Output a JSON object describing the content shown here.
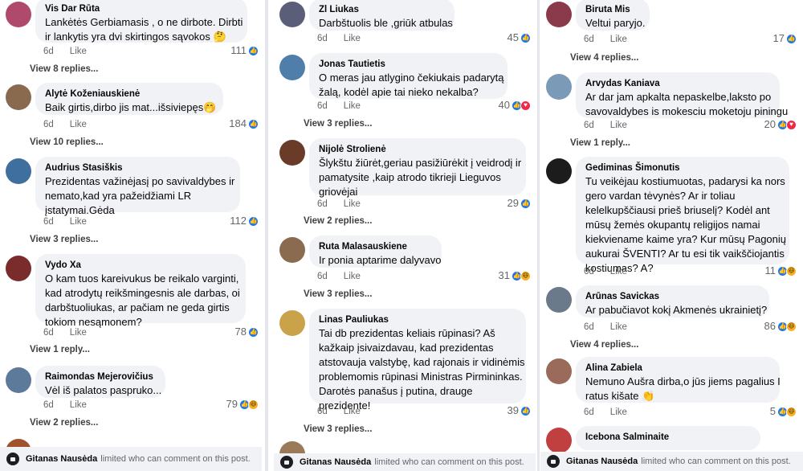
{
  "footer": {
    "name": "Gitanas Nausėda",
    "notice": "limited who can comment on this post."
  },
  "columns": [
    {
      "comments": [
        {
          "author": "Vis Dar Rūta",
          "lines": [
            "Lankėtės Gerbiamasis , o ne dirbote. Dirbti",
            "ir lankytis yra dvi skirtingos sąvokos 🤔"
          ],
          "time": "6d",
          "like": "Like",
          "count": "111",
          "reactions": [
            "like"
          ],
          "replies": "View 8 replies...",
          "avatar": "#b04a6c"
        },
        {
          "author": "Alytė Koženiauskienė",
          "lines": [
            "Baik girtis,dirbo jis mat...išsiviepęs🤭"
          ],
          "time": "6d",
          "like": "Like",
          "count": "184",
          "reactions": [
            "like"
          ],
          "replies": "View 10 replies...",
          "avatar": "#8a6a4e"
        },
        {
          "author": "Audrius Stasiškis",
          "lines": [
            "Prezidentas važinėjasį po savivaldybes ir",
            "nemato,kad yra pažeidžiami LR",
            "įstatymai.Gėda"
          ],
          "time": "6d",
          "like": "Like",
          "count": "112",
          "reactions": [
            "like"
          ],
          "replies": "View 3 replies...",
          "avatar": "#3f6f9e"
        },
        {
          "author": "Vydo Xa",
          "lines": [
            "O kam tuos kareivukus be reikalo varginti,",
            "kad atrodytų reikšmingesnis ale darbas, oi",
            "darbštuoliukas, ar pačiam ne geda girtis",
            "tokiom nesąmonem?"
          ],
          "time": "6d",
          "like": "Like",
          "count": "78",
          "reactions": [
            "like"
          ],
          "replies": "View 1 reply...",
          "avatar": "#7a2c2c"
        },
        {
          "author": "Raimondas Mejerovičius",
          "lines": [
            "Vėl iš palatos paspruko..."
          ],
          "time": "6d",
          "like": "Like",
          "count": "79",
          "reactions": [
            "like",
            "haha"
          ],
          "replies": "View 2 replies...",
          "avatar": "#5d7a9a"
        }
      ]
    },
    {
      "comments": [
        {
          "author": "Zl Liukas",
          "lines": [
            "Darbštuolis ble ,griūk atbulas"
          ],
          "time": "6d",
          "like": "Like",
          "count": "45",
          "reactions": [
            "like"
          ],
          "replies": "",
          "avatar": "#5a5e78"
        },
        {
          "author": "Jonas Tautietis",
          "lines": [
            "O meras jau atlygino čekiukais padarytą",
            "žalą, kodėl apie tai nieko nekalba?"
          ],
          "time": "6d",
          "like": "Like",
          "count": "40",
          "reactions": [
            "like",
            "love"
          ],
          "replies": "View 3 replies...",
          "avatar": "#4f7eaa"
        },
        {
          "author": "Nijolė Strolienė",
          "lines": [
            "Šlykštu žiūrėt,geriau pasižiūrėkit į veidrodį ir",
            "pamatysite ,kaip atrodo tikrieji Lieguvos",
            "griovėjai"
          ],
          "time": "6d",
          "like": "Like",
          "count": "29",
          "reactions": [
            "like"
          ],
          "replies": "View 2 replies...",
          "avatar": "#6b3b2a"
        },
        {
          "author": "Ruta Malasauskiene",
          "lines": [
            "Ir ponia aptarime dalyvavo"
          ],
          "time": "6d",
          "like": "Like",
          "count": "31",
          "reactions": [
            "like",
            "haha"
          ],
          "replies": "View 3 replies...",
          "avatar": "#8b6b50"
        },
        {
          "author": "Linas Pauliukas",
          "lines": [
            "Tai db prezidentas keliais rūpinasi? Aš",
            "kažkaip įsivaizdavau, kad prezidentas",
            "atstovauja valstybę, kad rajonais ir vidinėmis",
            "problemomis rūpinasi Ministras Pirmininkas.",
            "Darotės panašus į putina, drauge",
            "prezidente!"
          ],
          "time": "6d",
          "like": "Like",
          "count": "39",
          "reactions": [
            "like"
          ],
          "replies": "View 3 replies...",
          "avatar": "#c9a24a"
        }
      ]
    },
    {
      "comments": [
        {
          "author": "Biruta Mis",
          "lines": [
            "Veltui paryjo."
          ],
          "time": "6d",
          "like": "Like",
          "count": "17",
          "reactions": [
            "like"
          ],
          "replies": "View 4 replies...",
          "avatar": "#8a3a4a"
        },
        {
          "author": "Arvydas Kaniava",
          "lines": [
            "Ar dar jam apkalta nepaskelbe,laksto po",
            "savovaldybes is mokesciu moketoju piningu"
          ],
          "time": "6d",
          "like": "Like",
          "count": "20",
          "reactions": [
            "like",
            "love"
          ],
          "replies": "View 1 reply...",
          "avatar": "#7a9ab8"
        },
        {
          "author": "Gediminas Šimonutis",
          "lines": [
            "Tu veikėjau kostiumuotas, padarysi ka nors",
            "gero vardan tėvynės? Ar ir toliau",
            "kelelkupščiausi prieš briuselį? Kodėl ant",
            "mūsų žemės okupantų religijos namai",
            "kiekviename kaime yra? Kur mūsų Pagonių",
            "aukurai ŠVENTI? Ar tu esi tik vaikščiojantis",
            "kostiumas? A?"
          ],
          "time": "6d",
          "like": "Like",
          "count": "11",
          "reactions": [
            "like",
            "haha"
          ],
          "replies": "",
          "avatar": "#1c1c1c"
        },
        {
          "author": "Arūnas Savickas",
          "lines": [
            "Ar pabučiavot kokį Akmenės ukrainietį?"
          ],
          "time": "6d",
          "like": "Like",
          "count": "86",
          "reactions": [
            "like",
            "haha"
          ],
          "replies": "View 4 replies...",
          "avatar": "#6a7a8a"
        },
        {
          "author": "Alina Zabiela",
          "lines": [
            "Nemuno Aušra dirba,o jūs jiems pagalius I",
            "ratus kišate 👏"
          ],
          "time": "6d",
          "like": "Like",
          "count": "5",
          "reactions": [
            "like",
            "haha"
          ],
          "replies": "",
          "avatar": "#9a6a5a"
        },
        {
          "author": "Icebona Salminaite",
          "lines": [],
          "time": "",
          "like": "",
          "count": "",
          "reactions": [],
          "replies": "",
          "avatar": "#c04040"
        }
      ]
    }
  ]
}
